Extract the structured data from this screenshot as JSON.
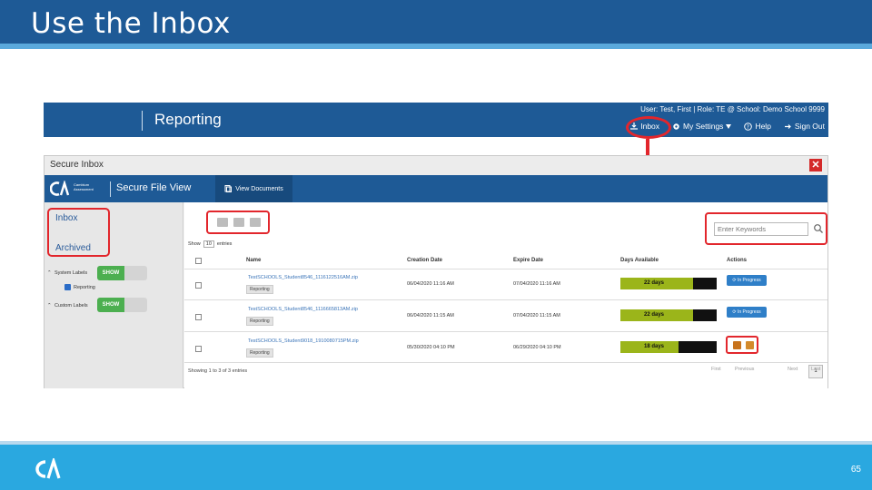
{
  "slide": {
    "title": "Use the Inbox",
    "page_number": "65",
    "colors": {
      "header": "#1e5a96",
      "footer": "#2aa8e0",
      "highlight": "#e2262c"
    }
  },
  "app_header": {
    "title": "Reporting",
    "user_line": "User: Test, First | Role: TE @ School: Demo School 9999",
    "menu": {
      "inbox": "Inbox",
      "settings": "My Settings",
      "help": "Help",
      "signout": "Sign Out"
    }
  },
  "dialog": {
    "title": "Secure Inbox",
    "close_icon": "close-icon",
    "band_title": "Secure File View",
    "brand_small": "Cambium Assessment",
    "view_documents": "View Documents"
  },
  "sidebar": {
    "inbox": "Inbox",
    "archived": "Archived",
    "system_labels": "System Labels",
    "reporting": "Reporting",
    "custom_labels": "Custom Labels",
    "show": "SHOW"
  },
  "table": {
    "search_placeholder": "Enter Keywords",
    "show_prefix": "Show",
    "show_value": "10",
    "show_suffix": "entries",
    "headers": {
      "name": "Name",
      "created": "Creation Date",
      "expire": "Expire Date",
      "days": "Days Available",
      "actions": "Actions"
    },
    "rows": [
      {
        "name": "TestSCHOOLS_Student8546_1116122516AM.zip",
        "tag": "Reporting",
        "created": "06/04/2020 11:16 AM",
        "expire": "07/04/2020 11:16 AM",
        "days": "22 days",
        "days_fraction": 0.75,
        "action": "In Progress"
      },
      {
        "name": "TestSCHOOLS_Student8546_1116665813AM.zip",
        "tag": "Reporting",
        "created": "06/04/2020 11:15 AM",
        "expire": "07/04/2020 11:15 AM",
        "days": "22 days",
        "days_fraction": 0.75,
        "action": "In Progress"
      },
      {
        "name": "TestSCHOOLS_Student9018_1910080715PM.zip",
        "tag": "Reporting",
        "created": "05/30/2020 04:10 PM",
        "expire": "06/29/2020 04:10 PM",
        "days": "18 days",
        "days_fraction": 0.6,
        "action": ""
      }
    ],
    "footer_info": "Showing 1 to 3 of 3 entries",
    "pager": {
      "first": "First",
      "previous": "Previous",
      "current": "1",
      "next": "Next",
      "last": "Last"
    }
  }
}
